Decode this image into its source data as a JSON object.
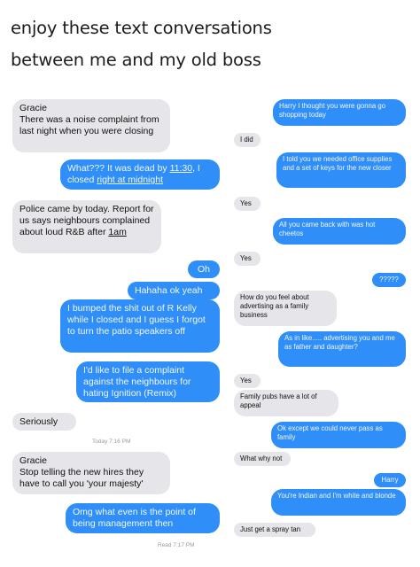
{
  "caption": {
    "line1": "enjoy these text conversations",
    "line2": "between me and my old boss"
  },
  "left_thread": {
    "messages": [
      {
        "from": "boss",
        "text": "Gracie\nThere was a noise complaint from last night when you were closing"
      },
      {
        "from": "me",
        "text_before": "What??? It was dead by ",
        "link1": "11:30",
        "text_middle": ", I closed ",
        "link2": "right at midnight"
      },
      {
        "from": "boss",
        "text_before": "Police came by today. Report for us says neighbours complained about loud R&B after ",
        "link": "1am"
      },
      {
        "from": "me",
        "text": "Oh"
      },
      {
        "from": "me",
        "text": "Hahaha ok yeah"
      },
      {
        "from": "me",
        "text": "I bumped the shit out of R Kelly while I closed and I guess I forgot to turn the patio speakers off"
      },
      {
        "from": "me",
        "text": "I'd like to file a complaint against the neighbours for hating Ignition (Remix)"
      },
      {
        "from": "boss",
        "text": "Seriously"
      },
      {
        "from": "boss",
        "text": "Gracie\nStop telling the new hires they have to call you 'your majesty'"
      },
      {
        "from": "me",
        "text": "Omg what even is the point of being management then"
      }
    ],
    "timestamp": "Today 7:16 PM",
    "read_receipt": "Read 7:17 PM"
  },
  "right_thread": {
    "messages": [
      {
        "from": "me",
        "text": "Harry I thought you were gonna go shopping today"
      },
      {
        "from": "boss",
        "text": "I did"
      },
      {
        "from": "me",
        "text": "I told you we needed office supplies and a set of keys for the new closer"
      },
      {
        "from": "boss",
        "text": "Yes"
      },
      {
        "from": "me",
        "text": "All you came back with was hot cheetos"
      },
      {
        "from": "boss",
        "text": "Yes"
      },
      {
        "from": "me",
        "text": "?????"
      },
      {
        "from": "boss",
        "text": "How do you feel about advertising as a family business"
      },
      {
        "from": "me",
        "text": "As in like..... advertising you and me as father and daughter?"
      },
      {
        "from": "boss",
        "text": "Yes"
      },
      {
        "from": "boss",
        "text": "Family pubs have a lot of appeal"
      },
      {
        "from": "me",
        "text": "Ok except we could never pass as family"
      },
      {
        "from": "boss",
        "text": "What why not"
      },
      {
        "from": "me",
        "text": "Harry"
      },
      {
        "from": "me",
        "text": "You're Indian and I'm white and blonde"
      },
      {
        "from": "boss",
        "text": "Just get a spray tan"
      }
    ]
  },
  "colors": {
    "incoming_bubble": "#e5e5ea",
    "outgoing_bubble": "#2f8ef8",
    "background": "#ffffff"
  }
}
